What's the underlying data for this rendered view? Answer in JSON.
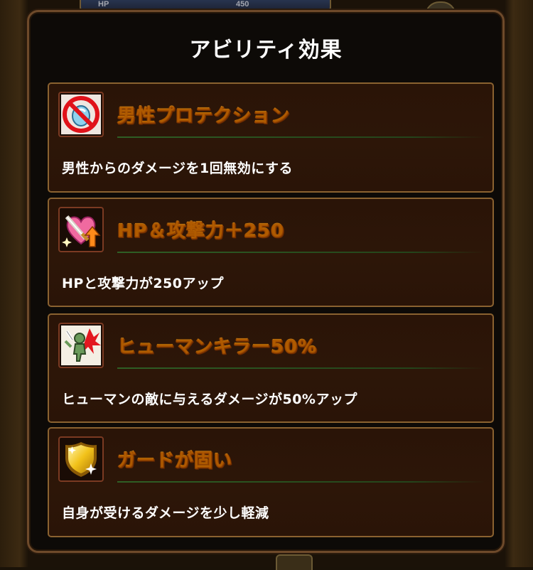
{
  "background": {
    "hp_label": "HP",
    "hp_value": "450"
  },
  "dialog": {
    "title": "アビリティ効果",
    "abilities": [
      {
        "name": "男性プロテクション",
        "description": "男性からのダメージを1回無効にする",
        "icon": "no-male-protection-icon"
      },
      {
        "name": "HP＆攻撃力＋250",
        "description": "HPと攻撃力が250アップ",
        "icon": "heart-sword-up-icon"
      },
      {
        "name": "ヒューマンキラー50%",
        "description": "ヒューマンの敵に与えるダメージが50%アップ",
        "icon": "human-killer-icon"
      },
      {
        "name": "ガードが固い",
        "description": "自身が受けるダメージを少し軽減",
        "icon": "gold-shield-icon"
      }
    ]
  },
  "colors": {
    "name_gold": "#ffd02a",
    "card_border": "#8a6230",
    "card_bg": "#2a1407",
    "dialog_border": "#6e4a2a"
  }
}
